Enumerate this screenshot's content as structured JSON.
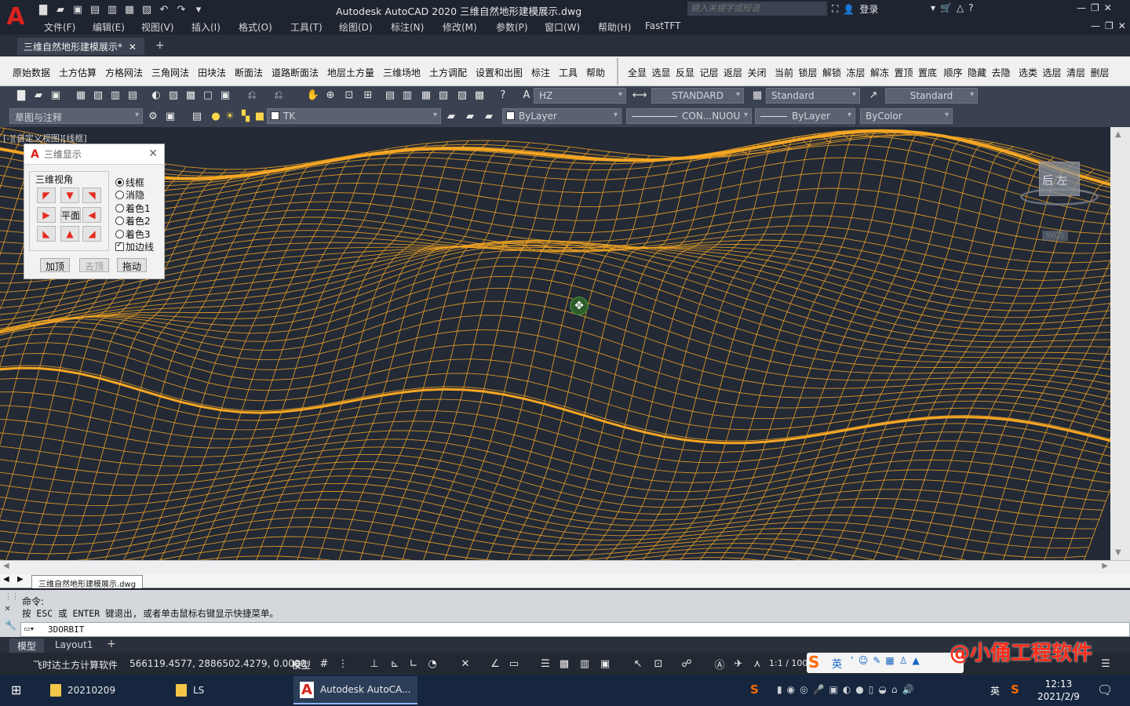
{
  "app": {
    "title": "Autodesk AutoCAD 2020    三维自然地形建模展示.dwg",
    "search_placeholder": "键入关键字或短语",
    "login_label": "登录"
  },
  "menu": [
    "文件(F)",
    "编辑(E)",
    "视图(V)",
    "插入(I)",
    "格式(O)",
    "工具(T)",
    "绘图(D)",
    "标注(N)",
    "修改(M)",
    "参数(P)",
    "窗口(W)",
    "帮助(H)",
    "FastTFT"
  ],
  "doc_tab": {
    "label": "三维自然地形建模展示*"
  },
  "custom_toolbar_left": [
    "原始数据",
    "土方估算",
    "方格网法",
    "三角网法",
    "田块法",
    "断面法",
    "道路断面法",
    "地层土方量",
    "三维场地",
    "土方调配",
    "设置和出图",
    "标注",
    "工具",
    "帮助"
  ],
  "custom_toolbar_right": [
    "全显",
    "选显",
    "反显",
    "记层",
    "返层",
    "关闭",
    "当前",
    "锁层",
    "解锁",
    "冻层",
    "解冻",
    "置顶",
    "置底",
    "顺序",
    "隐藏",
    "去隐",
    "选类",
    "选层",
    "清层",
    "删层"
  ],
  "toolbar2": {
    "text_style": "HZ",
    "dim_style": "STANDARD",
    "table_style": "Standard",
    "mleader_style": "Standard"
  },
  "toolbar3": {
    "workspace": "草图与注释",
    "layer": "TK",
    "color": "ByLayer",
    "linetype": "CON...NUOU",
    "lineweight": "ByLayer",
    "plotstyle": "ByColor"
  },
  "viewport": {
    "label": "[-][自定义视图][线框]"
  },
  "dialog": {
    "title": "三维显示",
    "group_label": "三维视角",
    "center_label": "平面",
    "radios": [
      {
        "label": "线框",
        "checked": true
      },
      {
        "label": "消隐",
        "checked": false
      },
      {
        "label": "着色1",
        "checked": false
      },
      {
        "label": "着色2",
        "checked": false
      },
      {
        "label": "着色3",
        "checked": false
      }
    ],
    "checkbox": {
      "label": "加边线",
      "checked": true
    },
    "buttons": [
      "加顶",
      "去顶",
      "拖动"
    ]
  },
  "viewcube": {
    "label": "后 左",
    "wcs": "WCS"
  },
  "file_tab": "三维自然地形建模展示.dwg",
  "command": {
    "line1": "命令:",
    "line2": "按 ESC 或 ENTER 键退出, 或者单击鼠标右键显示快捷菜单。",
    "input": "3DORBIT"
  },
  "layout_tabs": [
    "模型",
    "Layout1"
  ],
  "status": {
    "app_name": "飞时达土方计算软件",
    "coords": "566119.4577, 2886502.4279, 0.0000",
    "model": "模型",
    "scale": "1:1 / 100%"
  },
  "watermark": "@小俑工程软件",
  "taskbar": {
    "items": [
      "20210209",
      "LS",
      "Autodesk AutoCA..."
    ],
    "time": "12:13",
    "date": "2021/2/9",
    "ime": "英"
  },
  "colors": {
    "mesh": "#f5a623",
    "canvas": "#232a36",
    "accent": "#d9231e"
  }
}
